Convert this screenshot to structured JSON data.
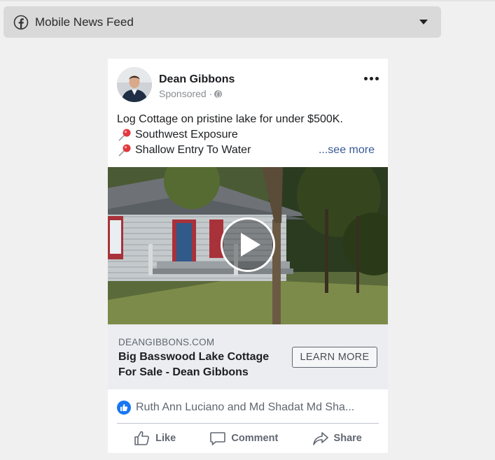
{
  "selector": {
    "label": "Mobile News Feed"
  },
  "post": {
    "author": "Dean Gibbons",
    "meta": "Sponsored ·",
    "text_lines": [
      "Log Cottage on pristine lake for under $500K.",
      "Southwest Exposure",
      "Shallow Entry To Water"
    ],
    "see_more": "...see more"
  },
  "link": {
    "domain": "DEANGIBBONS.COM",
    "title": "Big Basswood Lake Cottage For Sale - Dean Gibbons",
    "cta": "LEARN MORE"
  },
  "reactions": {
    "names": "Ruth Ann Luciano and Md Shadat Md Sha..."
  },
  "actions": {
    "like": "Like",
    "comment": "Comment",
    "share": "Share"
  },
  "colors": {
    "brand_blue": "#1877f2",
    "link_blue": "#385898",
    "page_bg": "#f0f0f0",
    "dropdown_bg": "#d9d9d9"
  }
}
